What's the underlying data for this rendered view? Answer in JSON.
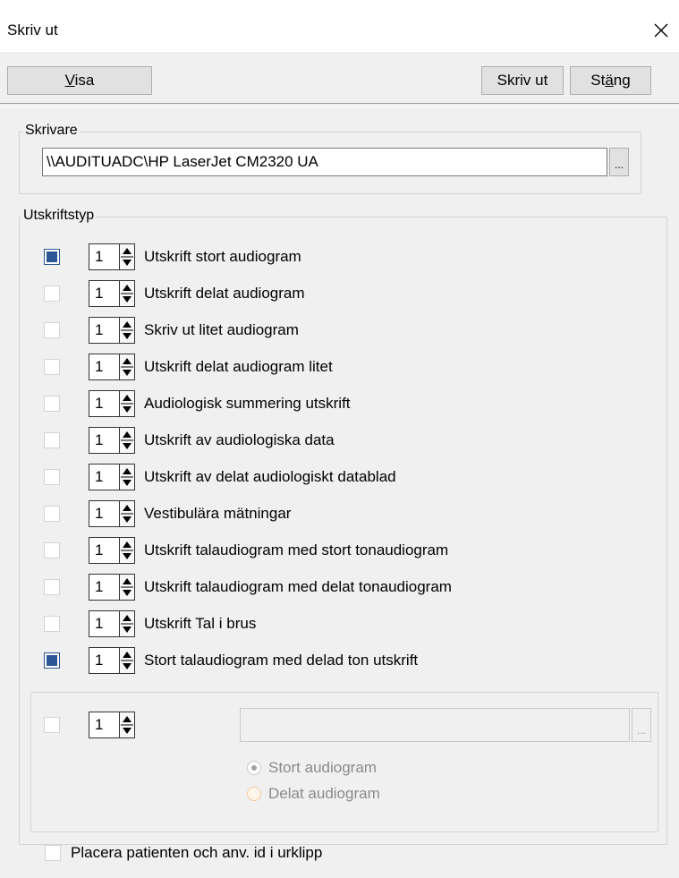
{
  "window": {
    "title": "Skriv ut"
  },
  "toolbar": {
    "visa_prefix": "",
    "visa_mnemonic": "V",
    "visa_rest": "isa",
    "print_label": "Skriv ut",
    "close_prefix": "St",
    "close_mnemonic": "ä",
    "close_rest": "ng"
  },
  "printer": {
    "legend": "Skrivare",
    "path": "\\\\AUDITUADC\\HP LaserJet CM2320 UA",
    "browse_label": "..."
  },
  "print_types": {
    "legend": "Utskriftstyp",
    "items": [
      {
        "label": "Utskrift stort audiogram",
        "copies": "1",
        "checked": true
      },
      {
        "label": "Utskrift delat audiogram",
        "copies": "1",
        "checked": false
      },
      {
        "label": "Skriv ut litet audiogram",
        "copies": "1",
        "checked": false
      },
      {
        "label": "Utskrift delat audiogram litet",
        "copies": "1",
        "checked": false
      },
      {
        "label": "Audiologisk summering utskrift",
        "copies": "1",
        "checked": false
      },
      {
        "label": "Utskrift av audiologiska data",
        "copies": "1",
        "checked": false
      },
      {
        "label": "Utskrift av delat audiologiskt datablad",
        "copies": "1",
        "checked": false
      },
      {
        "label": "Vestibulära mätningar",
        "copies": "1",
        "checked": false
      },
      {
        "label": "Utskrift talaudiogram med stort tonaudiogram",
        "copies": "1",
        "checked": false
      },
      {
        "label": "Utskrift talaudiogram med delat tonaudiogram",
        "copies": "1",
        "checked": false
      },
      {
        "label": "Utskrift Tal i brus",
        "copies": "1",
        "checked": false
      },
      {
        "label": "Stort talaudiogram med delad ton utskrift",
        "copies": "1",
        "checked": true
      }
    ]
  },
  "custom": {
    "copies": "1",
    "file_value": "",
    "browse_label": "...",
    "radio_large": "Stort audiogram",
    "radio_split": "Delat audiogram"
  },
  "clipboard": {
    "label": "Placera patienten och anv. id i urklipp"
  },
  "colors": {
    "accent": "#2b5797",
    "background": "#f0f0f0"
  }
}
